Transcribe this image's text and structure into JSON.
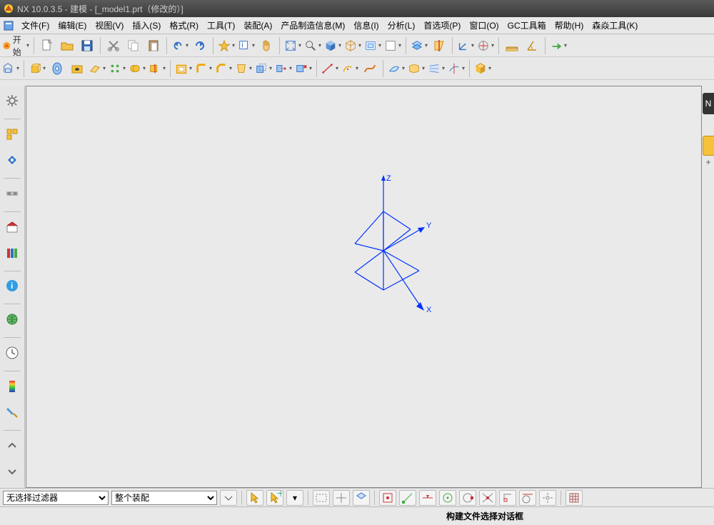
{
  "title": "NX 10.0.3.5 - 建模 - [_model1.prt（修改的）]",
  "menu": {
    "file": "文件(F)",
    "edit": "编辑(E)",
    "view": "视图(V)",
    "insert": "插入(S)",
    "format": "格式(R)",
    "tools": "工具(T)",
    "assemblies": "装配(A)",
    "pmi": "产品制造信息(M)",
    "info": "信息(I)",
    "analysis": "分析(L)",
    "preferences": "首选项(P)",
    "window": "窗口(O)",
    "gctoolbox": "GC工具箱",
    "help": "帮助(H)",
    "senyan": "森焱工具(K)"
  },
  "toolbar": {
    "start": "开始"
  },
  "bottom": {
    "filter_label": "无选择过滤器",
    "scope_label": "整个装配"
  },
  "status": {
    "msg": "构建文件选择对话框"
  },
  "viewport": {
    "axes": {
      "x": "X",
      "y": "Y",
      "z": "Z"
    }
  },
  "sidebar": {
    "items": [
      {
        "name": "part-navigator"
      },
      {
        "name": "assembly-navigator"
      },
      {
        "name": "constraint-navigator"
      },
      {
        "name": "reuse-library"
      },
      {
        "name": "hd3d-tools"
      },
      {
        "name": "web-browser"
      },
      {
        "name": "history"
      },
      {
        "name": "system-scene"
      },
      {
        "name": "roles"
      }
    ]
  },
  "colors": {
    "axis": "#0033ff"
  }
}
